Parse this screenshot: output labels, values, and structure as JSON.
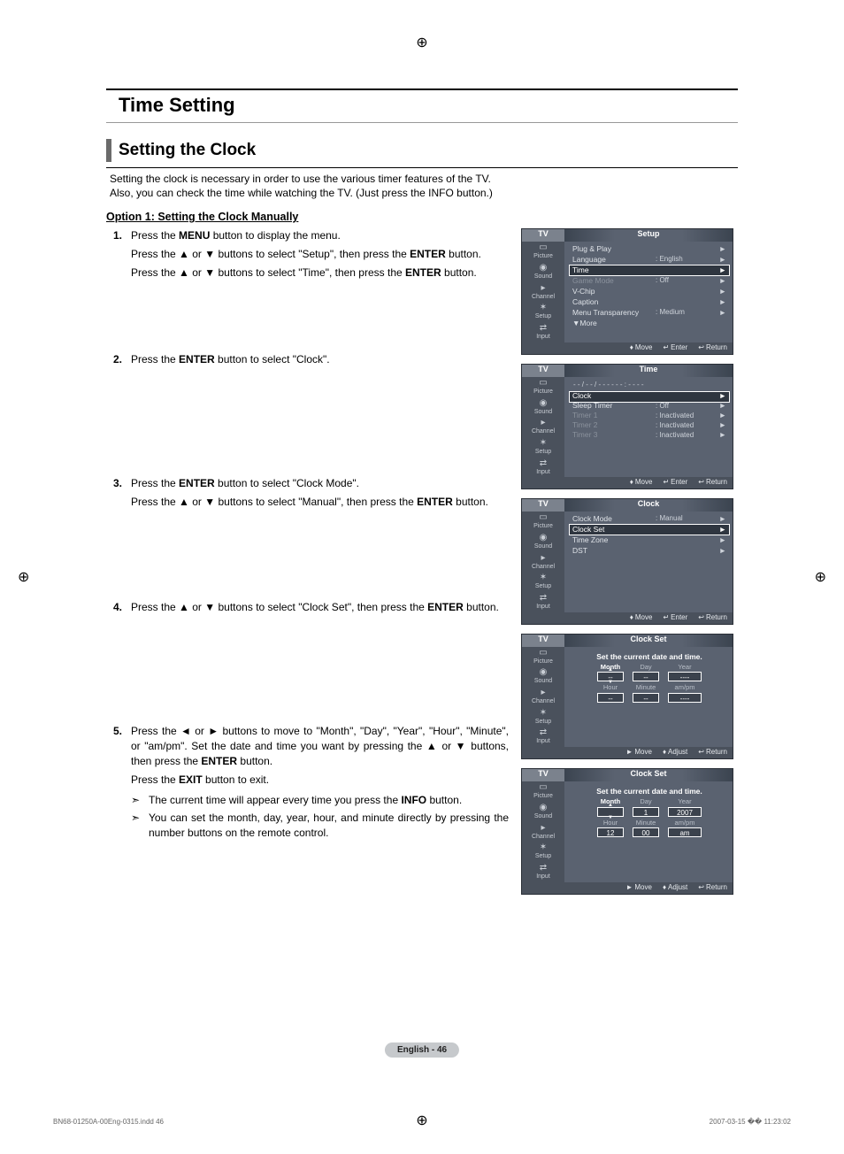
{
  "page": {
    "title": "Time Setting",
    "subsection": "Setting the Clock",
    "intro_line1": "Setting the clock is necessary in order to use the various timer features of the TV.",
    "intro_line2": "Also, you can check the time while watching the TV. (Just press the INFO button.)",
    "option1_header": "Option 1: Setting the Clock Manually",
    "footer_label": "English - 46",
    "file_footer_left": "BN68-01250A-00Eng-0315.indd   46",
    "file_footer_right": "2007-03-15   �� 11:23:02"
  },
  "glyphs": {
    "up": "▲",
    "down": "▼",
    "left": "◄",
    "right": "►",
    "enter": "↵",
    "return": "↩",
    "updown": "♦",
    "leftright": "↔",
    "note": "➣",
    "reg": "⊕"
  },
  "remote": {
    "menu": "MENU",
    "enter": "ENTER",
    "info": "INFO",
    "exit": "EXIT"
  },
  "steps": {
    "s1": {
      "num": "1.",
      "l1a": "Press the ",
      "l1b": " button to display the menu.",
      "l2a": "Press the ",
      "l2b": " or ",
      "l2c": " buttons to select \"Setup\", then press the ",
      "l2d": " button.",
      "l3a": "Press the ",
      "l3b": " or ",
      "l3c": " buttons to select \"Time\", then press the ",
      "l3d": " button."
    },
    "s2": {
      "num": "2.",
      "l1a": "Press the ",
      "l1b": " button to select \"Clock\"."
    },
    "s3": {
      "num": "3.",
      "l1a": "Press the ",
      "l1b": " button to select \"Clock Mode\".",
      "l2a": "Press the ",
      "l2b": " or ",
      "l2c": " buttons to select \"Manual\", then press the ",
      "l2d": " button."
    },
    "s4": {
      "num": "4.",
      "l1a": "Press the ",
      "l1b": " or ",
      "l1c": " buttons to select \"Clock Set\", then press the ",
      "l1d": " button."
    },
    "s5": {
      "num": "5.",
      "l1a": "Press the ",
      "l1b": " or ",
      "l1c": " buttons to move to \"Month\", \"Day\", \"Year\", \"Hour\", \"Minute\", or \"am/pm\". Set the date and time you want by pressing the ",
      "l1d": " or ",
      "l1e": " buttons, then press the ",
      "l1f": " button.",
      "l2a": "Press the ",
      "l2b": " button to exit.",
      "n1": "The current time will appear every time you press the ",
      "n1b": " button.",
      "n2": "You can set the month, day, year, hour, and minute directly by pressing the number buttons on the remote control."
    }
  },
  "osd_common": {
    "tv": "TV",
    "side": {
      "picture": "Picture",
      "sound": "Sound",
      "channel": "Channel",
      "setup": "Setup",
      "input": "Input"
    },
    "footer_move": "Move",
    "footer_enter": "Enter",
    "footer_return": "Return",
    "footer_adjust": "Adjust"
  },
  "osd1": {
    "title": "Setup",
    "rows": [
      {
        "lbl": "Plug & Play",
        "val": "",
        "arr": "►"
      },
      {
        "lbl": "Language",
        "val": ": English",
        "arr": "►"
      },
      {
        "lbl": "Time",
        "val": "",
        "arr": "►",
        "sel": true
      },
      {
        "lbl": "Game Mode",
        "val": ": Off",
        "arr": "►",
        "dis": true
      },
      {
        "lbl": "V-Chip",
        "val": "",
        "arr": "►"
      },
      {
        "lbl": "Caption",
        "val": "",
        "arr": "►"
      },
      {
        "lbl": "Menu Transparency",
        "val": ": Medium",
        "arr": "►"
      },
      {
        "lbl": "▼More",
        "val": "",
        "arr": "",
        "more": true
      }
    ]
  },
  "osd2": {
    "title": "Time",
    "subtext": "- - / - - / - - - -     - - : - -   - -",
    "rows": [
      {
        "lbl": "Clock",
        "val": "",
        "arr": "►",
        "sel": true
      },
      {
        "lbl": "Sleep Timer",
        "val": ": Off",
        "arr": "►"
      },
      {
        "lbl": "Timer 1",
        "val": ": Inactivated",
        "arr": "►",
        "dis": true
      },
      {
        "lbl": "Timer 2",
        "val": ": Inactivated",
        "arr": "►",
        "dis": true
      },
      {
        "lbl": "Timer 3",
        "val": ": Inactivated",
        "arr": "►",
        "dis": true
      }
    ]
  },
  "osd3": {
    "title": "Clock",
    "rows": [
      {
        "lbl": "Clock Mode",
        "val": ": Manual",
        "arr": "►"
      },
      {
        "lbl": "Clock Set",
        "val": "",
        "arr": "►",
        "sel": true
      },
      {
        "lbl": "Time Zone",
        "val": "",
        "arr": "►"
      },
      {
        "lbl": "DST",
        "val": "",
        "arr": "►"
      }
    ]
  },
  "osd4": {
    "title": "Clock Set",
    "caption": "Set the current date and time.",
    "hdr": {
      "month": "Month",
      "day": "Day",
      "year": "Year",
      "hour": "Hour",
      "minute": "Minute",
      "ampm": "am/pm"
    },
    "vals": {
      "month": "--",
      "day": "--",
      "year": "----",
      "hour": "--",
      "minute": "--",
      "ampm": "----"
    },
    "footer_move_glyph": "►"
  },
  "osd5": {
    "title": "Clock Set",
    "caption": "Set the current date and time.",
    "hdr": {
      "month": "Month",
      "day": "Day",
      "year": "Year",
      "hour": "Hour",
      "minute": "Minute",
      "ampm": "am/pm"
    },
    "vals": {
      "month": "",
      "day": "1",
      "year": "2007",
      "hour": "12",
      "minute": "00",
      "ampm": "am"
    }
  }
}
